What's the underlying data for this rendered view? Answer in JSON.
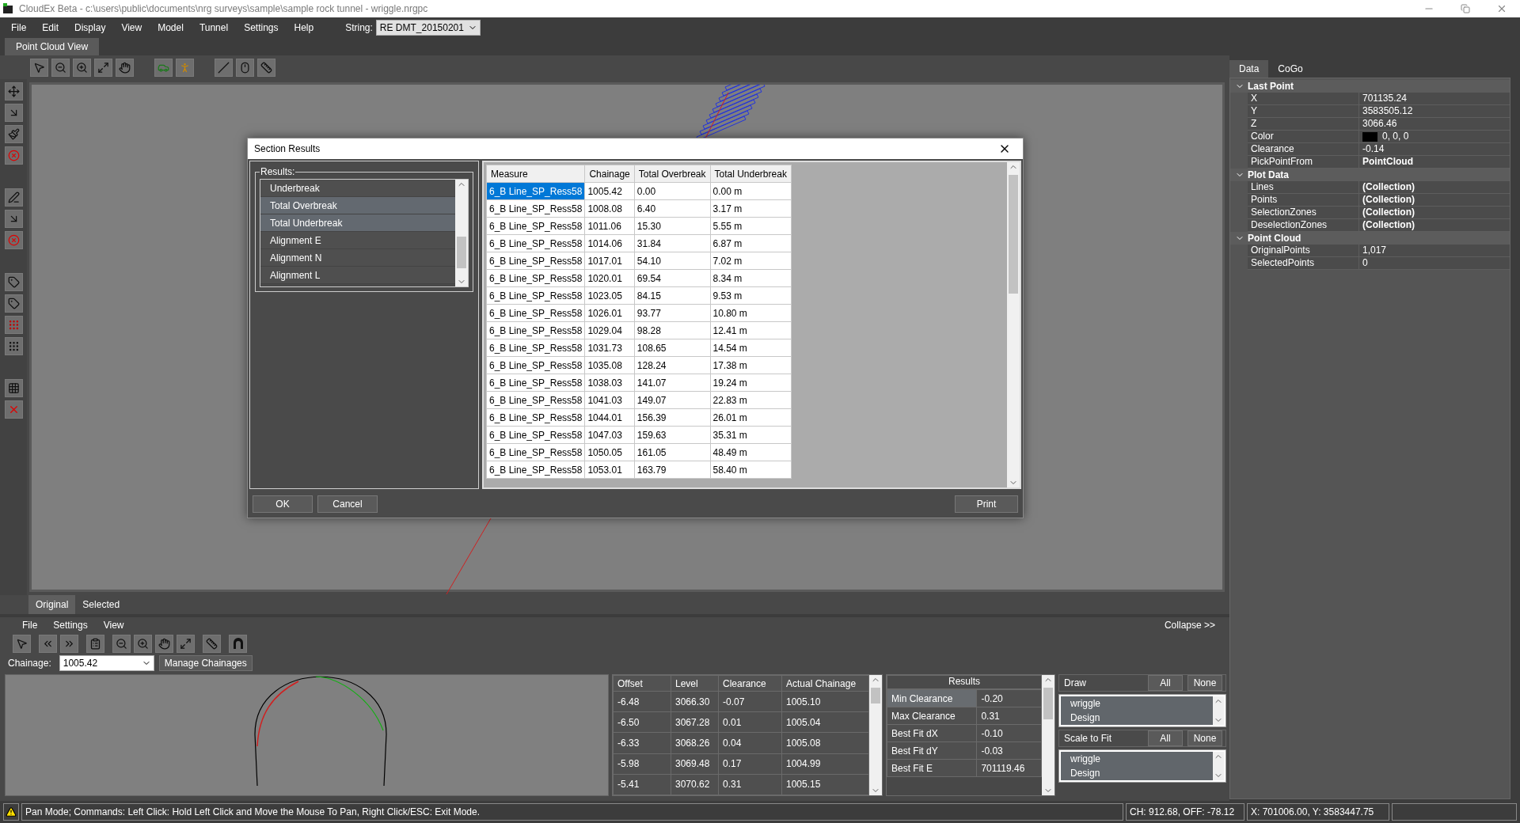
{
  "window": {
    "title": "CloudEx Beta - c:\\users\\public\\documents\\nrg surveys\\sample\\sample rock tunnel - wriggle.nrgpc"
  },
  "menu": [
    "File",
    "Edit",
    "Display",
    "View",
    "Model",
    "Tunnel",
    "Settings",
    "Help"
  ],
  "string_selector": {
    "label": "String:",
    "value": "RE DMT_20150201"
  },
  "document_tabs": [
    {
      "label": "Point Cloud View",
      "selected": true
    }
  ],
  "view_tabs": [
    {
      "label": "Original",
      "selected": true
    },
    {
      "label": "Selected",
      "selected": false
    }
  ],
  "dialog": {
    "title": "Section Results",
    "results_group": "Results:",
    "results_list": [
      {
        "label": "Underbreak",
        "selected": false
      },
      {
        "label": "Total Overbreak",
        "selected": true
      },
      {
        "label": "Total Underbreak",
        "selected": true
      },
      {
        "label": "Alignment E",
        "selected": false
      },
      {
        "label": "Alignment N",
        "selected": false
      },
      {
        "label": "Alignment L",
        "selected": false
      }
    ],
    "table": {
      "columns": [
        "Measure",
        "Chainage",
        "Total Overbreak",
        "Total Underbreak"
      ],
      "rows": [
        {
          "cells": [
            "6_B Line_SP_Ress58",
            "1005.42",
            "0.00",
            "0.00 m"
          ],
          "selected": true
        },
        {
          "cells": [
            "6_B Line_SP_Ress58",
            "1008.08",
            "6.40",
            "3.17 m"
          ],
          "selected": false
        },
        {
          "cells": [
            "6_B Line_SP_Ress58",
            "1011.06",
            "15.30",
            "5.55 m"
          ],
          "selected": false
        },
        {
          "cells": [
            "6_B Line_SP_Ress58",
            "1014.06",
            "31.84",
            "6.87 m"
          ],
          "selected": false
        },
        {
          "cells": [
            "6_B Line_SP_Ress58",
            "1017.01",
            "54.10",
            "7.02 m"
          ],
          "selected": false
        },
        {
          "cells": [
            "6_B Line_SP_Ress58",
            "1020.01",
            "69.54",
            "8.34 m"
          ],
          "selected": false
        },
        {
          "cells": [
            "6_B Line_SP_Ress58",
            "1023.05",
            "84.15",
            "9.53 m"
          ],
          "selected": false
        },
        {
          "cells": [
            "6_B Line_SP_Ress58",
            "1026.01",
            "93.77",
            "10.80 m"
          ],
          "selected": false
        },
        {
          "cells": [
            "6_B Line_SP_Ress58",
            "1029.04",
            "98.28",
            "12.41 m"
          ],
          "selected": false
        },
        {
          "cells": [
            "6_B Line_SP_Ress58",
            "1031.73",
            "108.65",
            "14.54 m"
          ],
          "selected": false
        },
        {
          "cells": [
            "6_B Line_SP_Ress58",
            "1035.08",
            "128.24",
            "17.38 m"
          ],
          "selected": false
        },
        {
          "cells": [
            "6_B Line_SP_Ress58",
            "1038.03",
            "141.07",
            "19.24 m"
          ],
          "selected": false
        },
        {
          "cells": [
            "6_B Line_SP_Ress58",
            "1041.03",
            "149.07",
            "22.83 m"
          ],
          "selected": false
        },
        {
          "cells": [
            "6_B Line_SP_Ress58",
            "1044.01",
            "156.39",
            "26.01 m"
          ],
          "selected": false
        },
        {
          "cells": [
            "6_B Line_SP_Ress58",
            "1047.03",
            "159.63",
            "35.31 m"
          ],
          "selected": false
        },
        {
          "cells": [
            "6_B Line_SP_Ress58",
            "1050.05",
            "161.05",
            "48.49 m"
          ],
          "selected": false
        },
        {
          "cells": [
            "6_B Line_SP_Ress58",
            "1053.01",
            "163.79",
            "58.40 m"
          ],
          "selected": false
        }
      ]
    },
    "buttons": {
      "ok": "OK",
      "cancel": "Cancel",
      "print": "Print"
    }
  },
  "section_panel": {
    "menu": [
      "File",
      "Settings",
      "View"
    ],
    "collapse": "Collapse >>",
    "chainage_label": "Chainage:",
    "chainage_value": "1005.42",
    "manage_button": "Manage Chainages",
    "points_table": {
      "columns": [
        "Offset",
        "Level",
        "Clearance",
        "Actual Chainage"
      ],
      "rows": [
        [
          "-6.48",
          "3066.30",
          "-0.07",
          "1005.10"
        ],
        [
          "-6.50",
          "3067.28",
          "0.01",
          "1005.04"
        ],
        [
          "-6.33",
          "3068.26",
          "0.04",
          "1005.08"
        ],
        [
          "-5.98",
          "3069.48",
          "0.17",
          "1004.99"
        ],
        [
          "-5.41",
          "3070.62",
          "0.31",
          "1005.15"
        ]
      ]
    },
    "results_table": {
      "title": "Results",
      "rows": [
        {
          "name": "Min Clearance",
          "value": "-0.20",
          "selected": true
        },
        {
          "name": "Max Clearance",
          "value": "0.31",
          "selected": false
        },
        {
          "name": "Best Fit dX",
          "value": "-0.10",
          "selected": false
        },
        {
          "name": "Best Fit dY",
          "value": "-0.03",
          "selected": false
        },
        {
          "name": "Best Fit E",
          "value": "701119.46",
          "selected": false
        }
      ]
    },
    "draw": {
      "title": "Draw",
      "all": "All",
      "none": "None",
      "items": [
        "wriggle",
        "Design"
      ]
    },
    "scale_to_fit": {
      "title": "Scale to Fit",
      "all": "All",
      "none": "None",
      "items": [
        "wriggle",
        "Design"
      ]
    }
  },
  "properties": {
    "tabs": [
      {
        "label": "Data",
        "selected": true
      },
      {
        "label": "CoGo",
        "selected": false
      }
    ],
    "categories": [
      {
        "name": "Last Point",
        "expanded": true,
        "items": [
          {
            "name": "X",
            "value": "701135.24",
            "bold": false
          },
          {
            "name": "Y",
            "value": "3583505.12",
            "bold": false
          },
          {
            "name": "Z",
            "value": "3066.46",
            "bold": false
          },
          {
            "name": "Color",
            "value": "0, 0, 0",
            "bold": false,
            "kind": "color"
          },
          {
            "name": "Clearance",
            "value": "-0.14",
            "bold": false
          },
          {
            "name": "PickPointFrom",
            "value": "PointCloud",
            "bold": true
          }
        ]
      },
      {
        "name": "Plot Data",
        "expanded": true,
        "items": [
          {
            "name": "Lines",
            "value": "(Collection)",
            "bold": true
          },
          {
            "name": "Points",
            "value": "(Collection)",
            "bold": true
          },
          {
            "name": "SelectionZones",
            "value": "(Collection)",
            "bold": true
          },
          {
            "name": "DeselectionZones",
            "value": "(Collection)",
            "bold": true
          }
        ]
      },
      {
        "name": "Point Cloud",
        "expanded": true,
        "items": [
          {
            "name": "OriginalPoints",
            "value": "1,017",
            "bold": false
          },
          {
            "name": "SelectedPoints",
            "value": "0",
            "bold": false
          }
        ]
      }
    ]
  },
  "status_bar": {
    "message": "Pan Mode; Commands: Left Click: Hold Left Click and Move the Mouse To Pan, Right Click/ESC: Exit Mode.",
    "chainage_offset": "CH: 912.68, OFF: -78.12",
    "coordinates": "X: 701006.00, Y: 3583447.75"
  }
}
